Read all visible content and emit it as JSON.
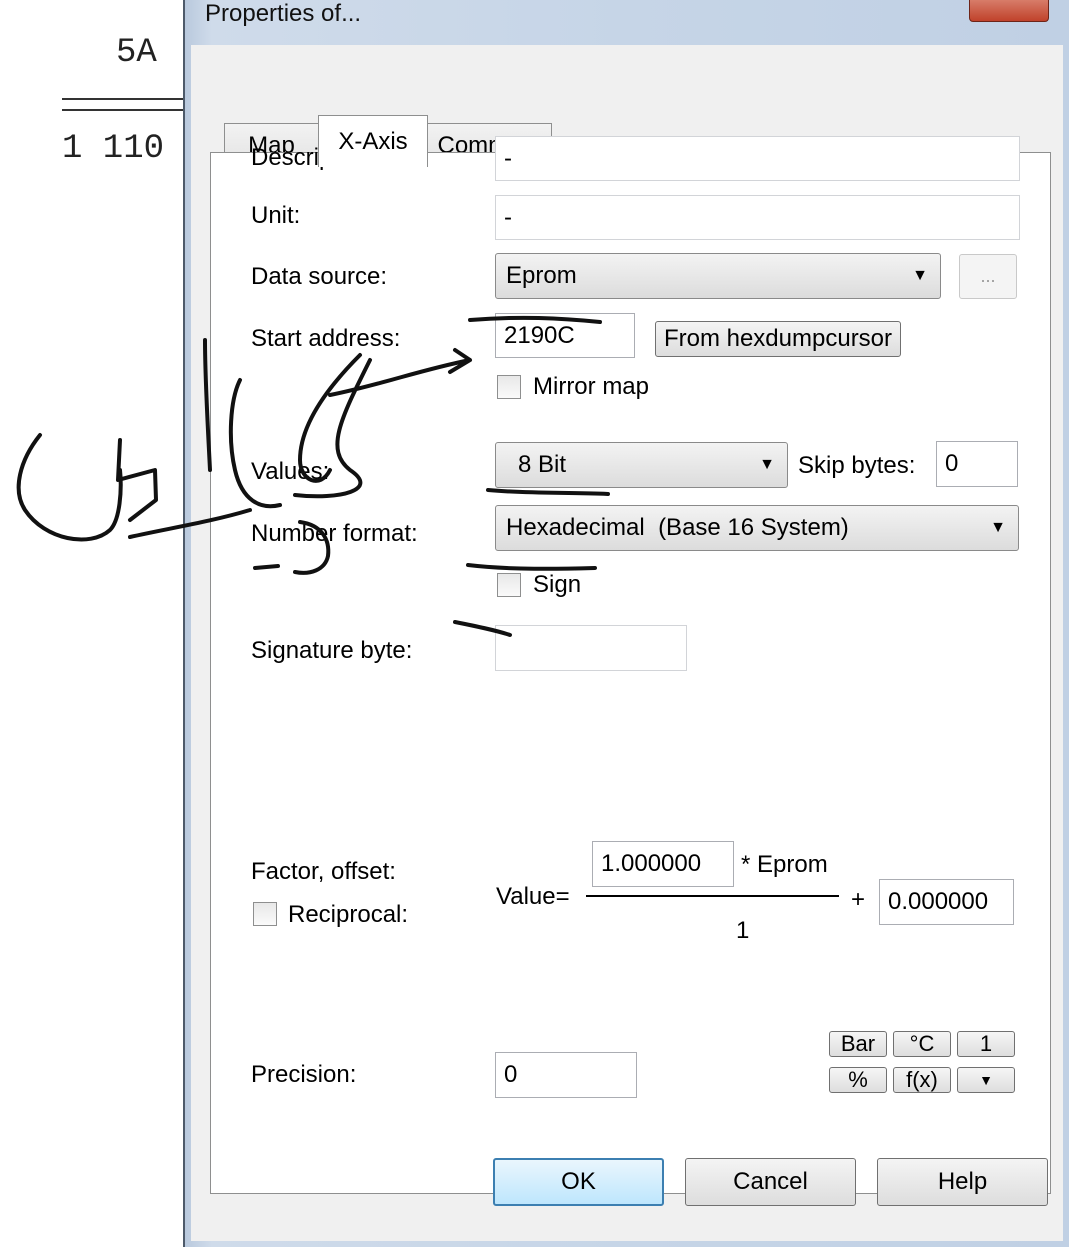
{
  "background": {
    "line1": "5A",
    "line2": "1 110"
  },
  "window": {
    "title": "Properties of..."
  },
  "tabs": [
    {
      "label": "Map",
      "active": false
    },
    {
      "label": "X-Axis",
      "active": true
    },
    {
      "label": "Comment",
      "active": false
    }
  ],
  "form": {
    "description_label": "Description:",
    "description_value": "-",
    "unit_label": "Unit:",
    "unit_value": "-",
    "data_source_label": "Data source:",
    "data_source_value": "Eprom",
    "browse_label": "...",
    "start_address_label": "Start address:",
    "start_address_value": "2190C",
    "from_hexdump_label": "From hexdumpcursor",
    "mirror_map_label": "Mirror map",
    "mirror_map_checked": false,
    "values_label": "Values:",
    "values_value": "8 Bit",
    "skip_bytes_label": "Skip bytes:",
    "skip_bytes_value": "0",
    "number_format_label": "Number format:",
    "number_format_value": "Hexadecimal  (Base 16 System)",
    "sign_label": "Sign",
    "sign_checked": false,
    "signature_byte_label": "Signature byte:",
    "signature_byte_value": "",
    "factor_offset_label": "Factor, offset:",
    "reciprocal_label": "Reciprocal:",
    "reciprocal_checked": false,
    "value_eq_label": "Value=",
    "factor_value": "1.000000",
    "multiplier_label": "* Eprom",
    "divisor_value": "1",
    "plus_label": "+",
    "offset_value": "0.000000",
    "precision_label": "Precision:",
    "precision_value": "0"
  },
  "tool_buttons": {
    "bar": "Bar",
    "celsius": "°C",
    "one": "1",
    "percent": "%",
    "fx": "f(x)",
    "more": "▼"
  },
  "footer": {
    "ok_label": "OK",
    "cancel_label": "Cancel",
    "help_label": "Help"
  },
  "colors": {
    "annotation_ink": "#111111",
    "window_frame": "#c6d5e7",
    "default_button_border": "#3c7fb1"
  }
}
